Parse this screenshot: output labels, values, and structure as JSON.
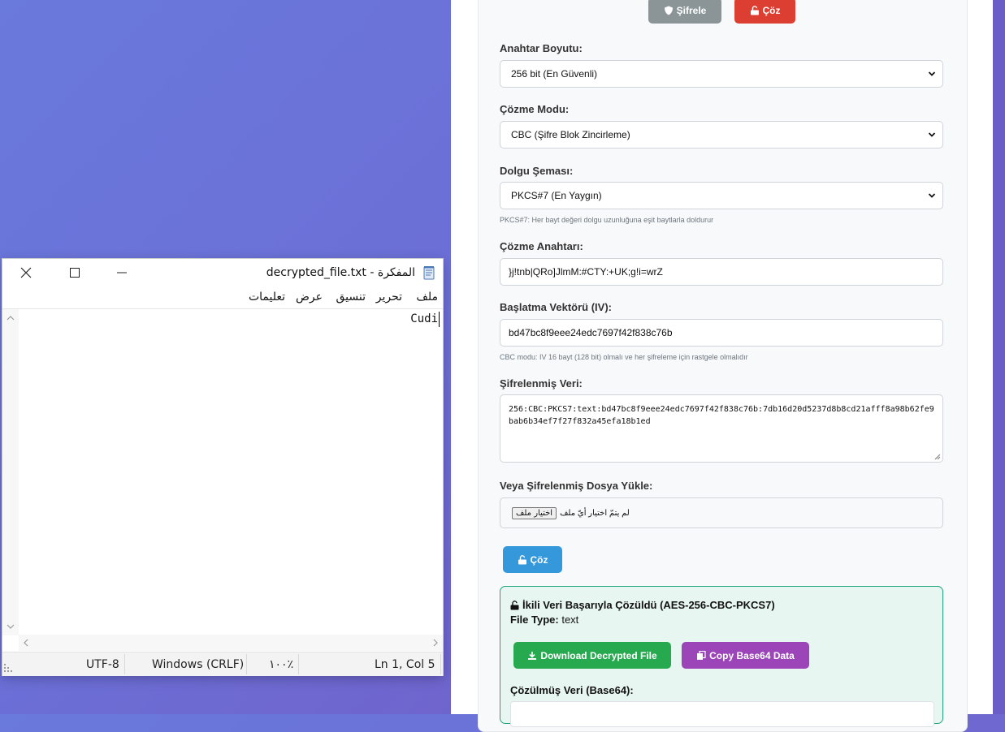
{
  "webapp": {
    "encrypt_button": "Şifrele",
    "decrypt_button_top": "Çöz",
    "key_size_label": "Anahtar Boyutu:",
    "key_size_value": "256 bit (En Güvenli)",
    "mode_label": "Çözme Modu:",
    "mode_value": "CBC (Şifre Blok Zincirleme)",
    "padding_label": "Dolgu Şeması:",
    "padding_value": "PKCS#7 (En Yaygın)",
    "padding_hint": "PKCS#7: Her bayt değeri dolgu uzunluğuna eşit baytlarla doldurur",
    "key_label": "Çözme Anahtarı:",
    "key_value": "}j!tnb|QRo]JlmM:#CTY:+UK;g!i=wrZ",
    "iv_label": "Başlatma Vektörü (IV):",
    "iv_value": "bd47bc8f9eee24edc7697f42f838c76b",
    "iv_hint": "CBC modu: IV 16 bayt (128 bit) olmalı ve her şifreleme için rastgele olmalıdır",
    "encrypted_label": "Şifrelenmiş Veri:",
    "encrypted_value": "256:CBC:PKCS7:text:bd47bc8f9eee24edc7697f42f838c76b:7db16d20d5237d8b8cd21afff8a98b62fe9bab6b34ef7f27f832a45efa18b1ed",
    "file_label": "Veya Şifrelenmiş Dosya Yükle:",
    "file_button": "اختيار ملف",
    "file_status": "لم يتمّ اختيار أيّ ملف",
    "decrypt_button": "Çöz",
    "result": {
      "title": "İkili Veri Başarıyla Çözüldü (AES-256-CBC-PKCS7)",
      "file_type_label": "File Type:",
      "file_type_value": "text",
      "download_button": "Download Decrypted File",
      "copy_button": "Copy Base64 Data",
      "data_label": "Çözülmüş Veri (Base64):"
    },
    "colors": {
      "encrypt_btn": "#8b9597",
      "decrypt_top_btn": "#dc3f32",
      "decrypt_btn": "#3498db",
      "download_btn": "#27a94f",
      "copy_btn": "#9b45b8",
      "result_border": "#20a37a",
      "result_bg": "#e8f6f1"
    }
  },
  "notepad": {
    "title": "المفكرة - decrypted_file.txt",
    "menu": [
      "ملف",
      "تحرير",
      "تنسيق",
      "عرض",
      "تعليمات"
    ],
    "content": "Cudi",
    "status": {
      "position": "Ln 1, Col 5",
      "zoom": "١٠٠٪",
      "line_ending": "Windows (CRLF)",
      "encoding": "UTF-8"
    }
  }
}
